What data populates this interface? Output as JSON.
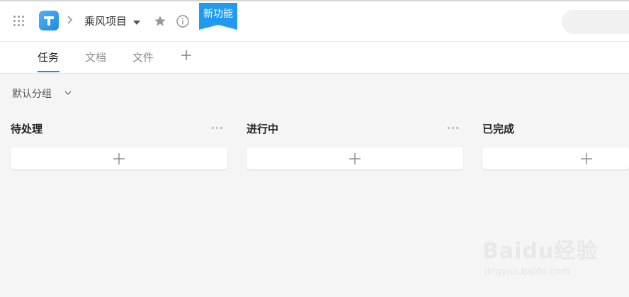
{
  "header": {
    "project_name": "乘风项目",
    "new_feature_badge": "新功能",
    "accent_color": "#1e88e5",
    "icons": [
      "apps-grid-icon",
      "app-logo-icon",
      "chevron-right-icon",
      "caret-down-icon",
      "star-icon",
      "info-icon"
    ]
  },
  "tabs": [
    {
      "label": "任务",
      "active": true
    },
    {
      "label": "文档",
      "active": false
    },
    {
      "label": "文件",
      "active": false
    }
  ],
  "group_selector": {
    "label": "默认分组"
  },
  "columns": [
    {
      "title": "待处理",
      "has_more_menu": true
    },
    {
      "title": "进行中",
      "has_more_menu": true
    },
    {
      "title": "已完成",
      "has_more_menu": false
    }
  ],
  "watermark": {
    "line1": "Baidu经验",
    "line2": "jingyan.baidu.com"
  }
}
